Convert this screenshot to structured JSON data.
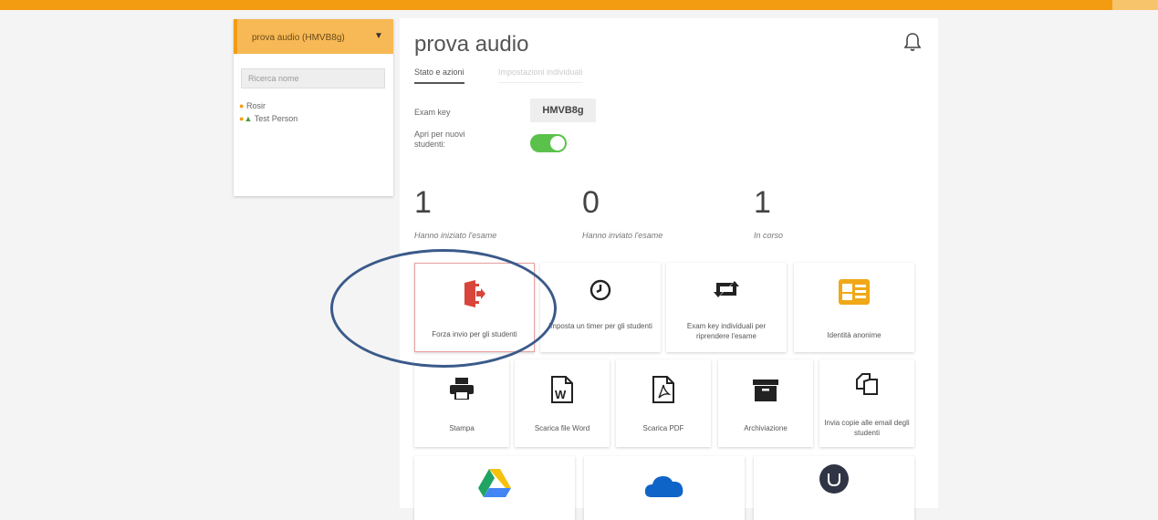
{
  "sidebar": {
    "exam_select": "prova audio (HMVB8g)",
    "search_placeholder": "Ricerca nome",
    "students": [
      "Rosir",
      "Test Person"
    ]
  },
  "main": {
    "title": "prova audio",
    "tabs": [
      "Stato e azioni",
      "Impostazioni individuali"
    ],
    "exam_key_label": "Exam key",
    "exam_key_value": "HMVB8g",
    "open_label": "Apri per nuovi studenti:",
    "open_enabled": true
  },
  "stats": [
    {
      "value": "1",
      "label": "Hanno iniziato l'esame"
    },
    {
      "value": "0",
      "label": "Hanno inviato l'esame"
    },
    {
      "value": "1",
      "label": "In corso"
    }
  ],
  "actions_row1": [
    {
      "label": "Forza invio per gli studenti",
      "icon": "exit-icon"
    },
    {
      "label": "Imposta un timer per gli studenti",
      "icon": "clock-icon"
    },
    {
      "label": "Exam key individuali per riprendere l'esame",
      "icon": "retweet-icon"
    },
    {
      "label": "Identità anonime",
      "icon": "id-card-icon"
    }
  ],
  "actions_row2": [
    {
      "label": "Stampa",
      "icon": "printer-icon"
    },
    {
      "label": "Scarica file Word",
      "icon": "word-file-icon"
    },
    {
      "label": "Scarica PDF",
      "icon": "pdf-file-icon"
    },
    {
      "label": "Archiviazione",
      "icon": "archive-icon"
    },
    {
      "label": "Invia copie alle email degli studenti",
      "icon": "copy-icon"
    }
  ],
  "actions_row3": [
    {
      "icon": "google-drive-icon"
    },
    {
      "icon": "onedrive-icon"
    },
    {
      "icon": "unicheck-icon"
    }
  ],
  "colors": {
    "accent": "#f39c12",
    "toggle_on": "#5ac14b",
    "exit_icon": "#d8453a",
    "highlight_ellipse": "#3b5a8a"
  }
}
